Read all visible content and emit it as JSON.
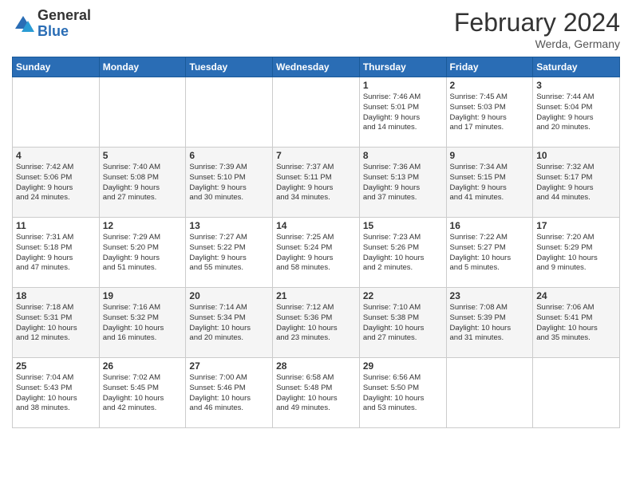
{
  "logo": {
    "general": "General",
    "blue": "Blue"
  },
  "title": {
    "month": "February 2024",
    "location": "Werda, Germany"
  },
  "weekdays": [
    "Sunday",
    "Monday",
    "Tuesday",
    "Wednesday",
    "Thursday",
    "Friday",
    "Saturday"
  ],
  "weeks": [
    [
      {
        "day": "",
        "info": ""
      },
      {
        "day": "",
        "info": ""
      },
      {
        "day": "",
        "info": ""
      },
      {
        "day": "",
        "info": ""
      },
      {
        "day": "1",
        "info": "Sunrise: 7:46 AM\nSunset: 5:01 PM\nDaylight: 9 hours\nand 14 minutes."
      },
      {
        "day": "2",
        "info": "Sunrise: 7:45 AM\nSunset: 5:03 PM\nDaylight: 9 hours\nand 17 minutes."
      },
      {
        "day": "3",
        "info": "Sunrise: 7:44 AM\nSunset: 5:04 PM\nDaylight: 9 hours\nand 20 minutes."
      }
    ],
    [
      {
        "day": "4",
        "info": "Sunrise: 7:42 AM\nSunset: 5:06 PM\nDaylight: 9 hours\nand 24 minutes."
      },
      {
        "day": "5",
        "info": "Sunrise: 7:40 AM\nSunset: 5:08 PM\nDaylight: 9 hours\nand 27 minutes."
      },
      {
        "day": "6",
        "info": "Sunrise: 7:39 AM\nSunset: 5:10 PM\nDaylight: 9 hours\nand 30 minutes."
      },
      {
        "day": "7",
        "info": "Sunrise: 7:37 AM\nSunset: 5:11 PM\nDaylight: 9 hours\nand 34 minutes."
      },
      {
        "day": "8",
        "info": "Sunrise: 7:36 AM\nSunset: 5:13 PM\nDaylight: 9 hours\nand 37 minutes."
      },
      {
        "day": "9",
        "info": "Sunrise: 7:34 AM\nSunset: 5:15 PM\nDaylight: 9 hours\nand 41 minutes."
      },
      {
        "day": "10",
        "info": "Sunrise: 7:32 AM\nSunset: 5:17 PM\nDaylight: 9 hours\nand 44 minutes."
      }
    ],
    [
      {
        "day": "11",
        "info": "Sunrise: 7:31 AM\nSunset: 5:18 PM\nDaylight: 9 hours\nand 47 minutes."
      },
      {
        "day": "12",
        "info": "Sunrise: 7:29 AM\nSunset: 5:20 PM\nDaylight: 9 hours\nand 51 minutes."
      },
      {
        "day": "13",
        "info": "Sunrise: 7:27 AM\nSunset: 5:22 PM\nDaylight: 9 hours\nand 55 minutes."
      },
      {
        "day": "14",
        "info": "Sunrise: 7:25 AM\nSunset: 5:24 PM\nDaylight: 9 hours\nand 58 minutes."
      },
      {
        "day": "15",
        "info": "Sunrise: 7:23 AM\nSunset: 5:26 PM\nDaylight: 10 hours\nand 2 minutes."
      },
      {
        "day": "16",
        "info": "Sunrise: 7:22 AM\nSunset: 5:27 PM\nDaylight: 10 hours\nand 5 minutes."
      },
      {
        "day": "17",
        "info": "Sunrise: 7:20 AM\nSunset: 5:29 PM\nDaylight: 10 hours\nand 9 minutes."
      }
    ],
    [
      {
        "day": "18",
        "info": "Sunrise: 7:18 AM\nSunset: 5:31 PM\nDaylight: 10 hours\nand 12 minutes."
      },
      {
        "day": "19",
        "info": "Sunrise: 7:16 AM\nSunset: 5:32 PM\nDaylight: 10 hours\nand 16 minutes."
      },
      {
        "day": "20",
        "info": "Sunrise: 7:14 AM\nSunset: 5:34 PM\nDaylight: 10 hours\nand 20 minutes."
      },
      {
        "day": "21",
        "info": "Sunrise: 7:12 AM\nSunset: 5:36 PM\nDaylight: 10 hours\nand 23 minutes."
      },
      {
        "day": "22",
        "info": "Sunrise: 7:10 AM\nSunset: 5:38 PM\nDaylight: 10 hours\nand 27 minutes."
      },
      {
        "day": "23",
        "info": "Sunrise: 7:08 AM\nSunset: 5:39 PM\nDaylight: 10 hours\nand 31 minutes."
      },
      {
        "day": "24",
        "info": "Sunrise: 7:06 AM\nSunset: 5:41 PM\nDaylight: 10 hours\nand 35 minutes."
      }
    ],
    [
      {
        "day": "25",
        "info": "Sunrise: 7:04 AM\nSunset: 5:43 PM\nDaylight: 10 hours\nand 38 minutes."
      },
      {
        "day": "26",
        "info": "Sunrise: 7:02 AM\nSunset: 5:45 PM\nDaylight: 10 hours\nand 42 minutes."
      },
      {
        "day": "27",
        "info": "Sunrise: 7:00 AM\nSunset: 5:46 PM\nDaylight: 10 hours\nand 46 minutes."
      },
      {
        "day": "28",
        "info": "Sunrise: 6:58 AM\nSunset: 5:48 PM\nDaylight: 10 hours\nand 49 minutes."
      },
      {
        "day": "29",
        "info": "Sunrise: 6:56 AM\nSunset: 5:50 PM\nDaylight: 10 hours\nand 53 minutes."
      },
      {
        "day": "",
        "info": ""
      },
      {
        "day": "",
        "info": ""
      }
    ]
  ]
}
